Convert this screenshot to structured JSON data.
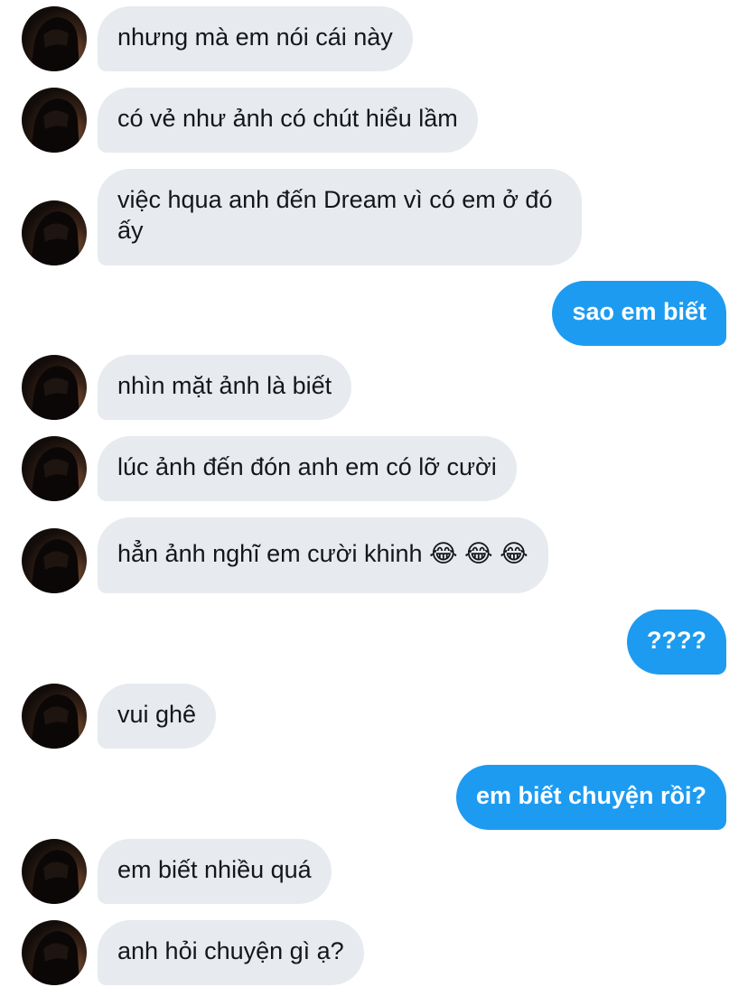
{
  "conversation": {
    "messages": [
      {
        "text": "nhưng mà em nói cái này"
      },
      {
        "text": "có vẻ như ảnh có chút hiểu lầm"
      },
      {
        "text": "việc hqua anh đến Dream vì có em ở đó ấy"
      },
      {
        "text": "sao em biết"
      },
      {
        "text": "nhìn mặt ảnh là biết"
      },
      {
        "text": "lúc ảnh đến đón anh em có lỡ cười"
      },
      {
        "text": "hẳn ảnh nghĩ em cười khinh 😂 😂 😂"
      },
      {
        "text": "????"
      },
      {
        "text": "vui ghê"
      },
      {
        "text": "em biết chuyện rồi?"
      },
      {
        "text": "em biết nhiều quá"
      },
      {
        "text": "anh hỏi chuyện gì ạ?"
      }
    ]
  },
  "colors": {
    "incoming_bubble": "#e7eaee",
    "outgoing_bubble": "#1d9bf0",
    "incoming_text": "#14171a",
    "outgoing_text": "#ffffff"
  },
  "icons": {
    "avatar": "contact-avatar"
  }
}
